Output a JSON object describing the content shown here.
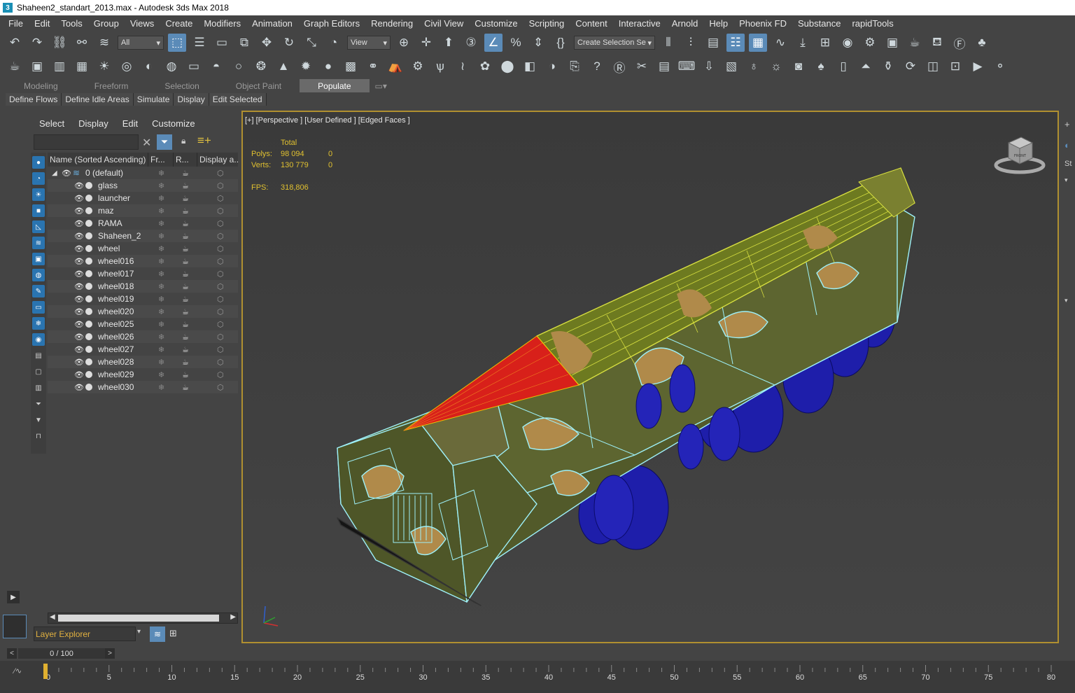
{
  "window": {
    "title": "Shaheen2_standart_2013.max - Autodesk 3ds Max 2018",
    "app_icon": "3"
  },
  "menu": [
    "File",
    "Edit",
    "Tools",
    "Group",
    "Views",
    "Create",
    "Modifiers",
    "Animation",
    "Graph Editors",
    "Rendering",
    "Civil View",
    "Customize",
    "Scripting",
    "Content",
    "Interactive",
    "Arnold",
    "Help",
    "Phoenix FD",
    "Substance",
    "rapidTools"
  ],
  "toolbar": {
    "selection_filter": "All",
    "reference_coord": "View",
    "named_selection": "Create Selection Se"
  },
  "ribbon": {
    "tabs": [
      "Modeling",
      "Freeform",
      "Selection",
      "Object Paint",
      "Populate"
    ],
    "active_tab": "Populate",
    "buttons": [
      "Define Flows",
      "Define Idle Areas",
      "Simulate",
      "Display",
      "Edit Selected"
    ]
  },
  "scene_explorer": {
    "menu": [
      "Select",
      "Display",
      "Edit",
      "Customize"
    ],
    "columns": [
      "Name (Sorted Ascending)",
      "Fr...",
      "R...",
      "Display a..."
    ],
    "layer": "0 (default)",
    "objects": [
      "glass",
      "launcher",
      "maz",
      "RAMA",
      "Shaheen_2",
      "wheel",
      "wheel016",
      "wheel017",
      "wheel018",
      "wheel019",
      "wheel020",
      "wheel025",
      "wheel026",
      "wheel027",
      "wheel028",
      "wheel029",
      "wheel030"
    ],
    "footer": "Layer Explorer"
  },
  "viewport": {
    "label": "[+] [Perspective ] [User Defined ] [Edged Faces ]",
    "stats": {
      "total_label": "Total",
      "polys_label": "Polys:",
      "polys_total": "98 094",
      "polys_sel": "0",
      "verts_label": "Verts:",
      "verts_total": "130 779",
      "verts_sel": "0",
      "fps_label": "FPS:",
      "fps": "318,806"
    },
    "viewcube_label": "FRONT"
  },
  "right_strip": {
    "label": "St"
  },
  "timeline": {
    "slider": "0 / 100",
    "ticks": [
      "0",
      "5",
      "10",
      "15",
      "20",
      "25",
      "30",
      "35",
      "40",
      "45",
      "50",
      "55",
      "60",
      "65",
      "70",
      "75",
      "80"
    ]
  },
  "colors": {
    "accent": "#5b8bb8",
    "viewport_border": "#b09030",
    "stats_text": "#e0c030",
    "wire_cyan": "#9ef0f8",
    "wire_yellow": "#d8e040",
    "warhead_red": "#d8201a",
    "wheel_blue": "#2020b0",
    "camo_olive": "#525a2a",
    "camo_tan": "#b08a4a"
  }
}
